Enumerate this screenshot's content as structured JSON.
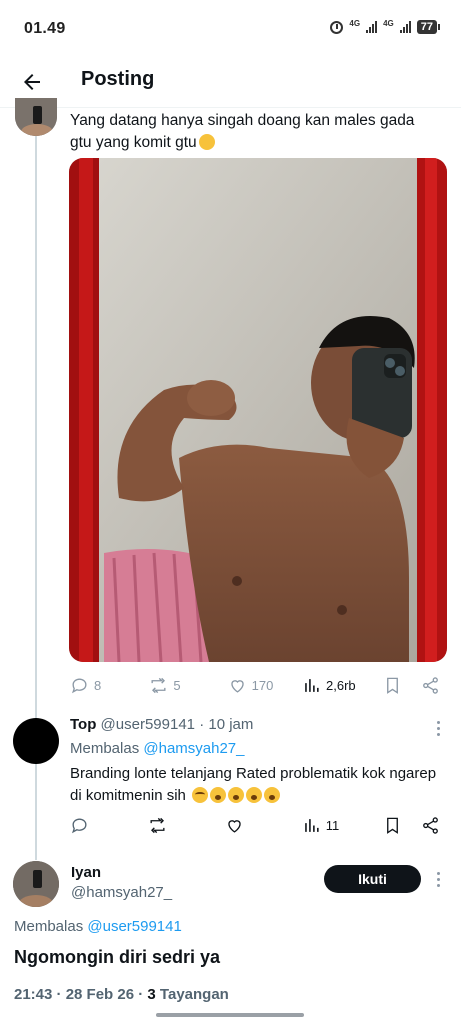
{
  "status_bar": {
    "time": "01.49",
    "network_1": "4G",
    "network_2": "4G",
    "battery": "77"
  },
  "header": {
    "title": "Posting"
  },
  "main_post": {
    "text": "Yang datang hanya singah doang kan males gada gtu yang komit gtu",
    "stats": {
      "replies": "8",
      "reposts": "5",
      "likes": "170",
      "views": "2,6rb"
    }
  },
  "reply_1": {
    "name": "Top",
    "handle": "@user599141",
    "time": "· 10 jam",
    "replying_label": "Membalas",
    "replying_to": "@hamsyah27_",
    "text": "Branding lonte telanjang Rated problematik kok ngarep di komitmenin sih",
    "views": "11"
  },
  "focused_post": {
    "name": "Iyan",
    "handle": "@hamsyah27_",
    "follow_label": "Ikuti",
    "replying_label": "Membalas",
    "replying_to": "@user599141",
    "text": "Ngomongin diri sedri ya",
    "timestamp": "21:43 · 28 Feb 26 ·",
    "views_count": "3",
    "views_label": "Tayangan"
  },
  "colors": {
    "accent": "#1d9bf0",
    "text": "#0f1419",
    "muted": "#536471",
    "icon": "#8b98a5"
  }
}
